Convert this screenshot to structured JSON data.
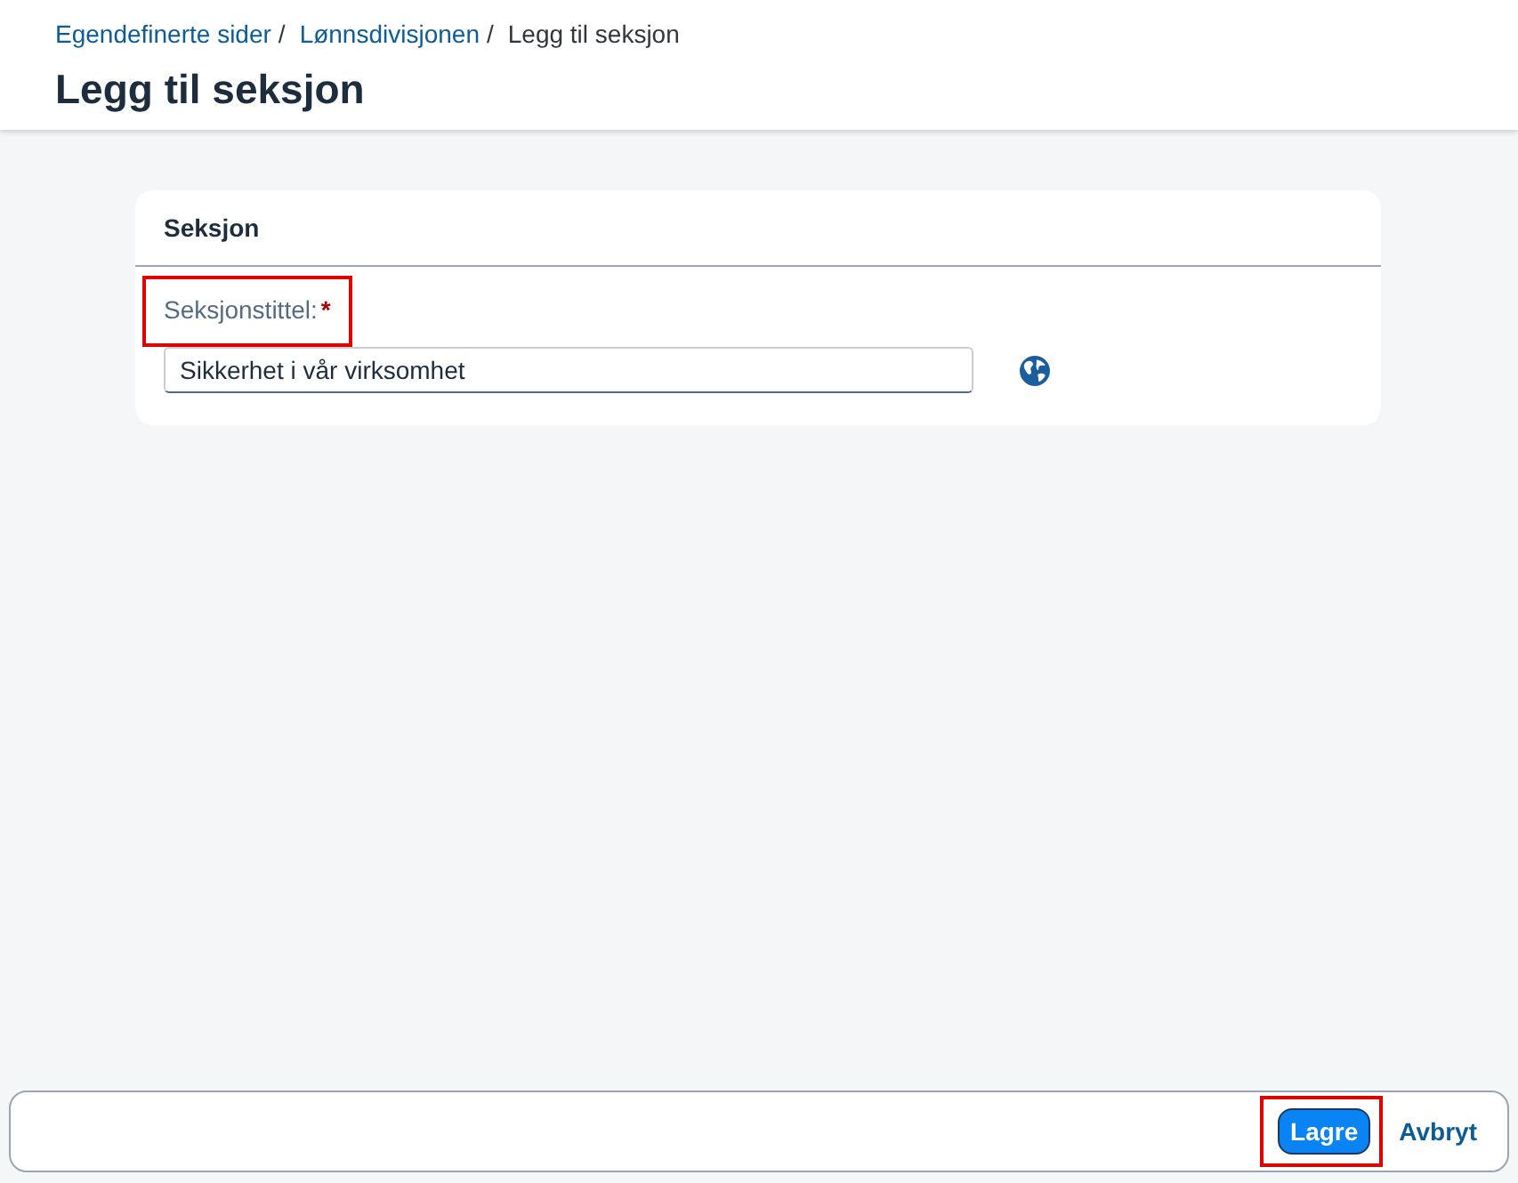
{
  "breadcrumb": [
    {
      "label": "Egendefinerte sider",
      "kind": "link",
      "separator": "/"
    },
    {
      "label": "Lønnsdivisjonen",
      "kind": "link",
      "separator": "/"
    },
    {
      "label": "Legg til seksjon",
      "kind": "current"
    }
  ],
  "page_title": "Legg til seksjon",
  "section": {
    "title": "Seksjon",
    "fields": [
      {
        "label": "Seksjonstittel:",
        "required_mark": "*",
        "value": "Sikkerhet i vår virksomhet",
        "highlighted": true
      }
    ]
  },
  "footer": {
    "buttons": [
      {
        "label": "Lagre",
        "kind": "primary",
        "highlighted": true
      },
      {
        "label": "Avbryt",
        "kind": "link",
        "highlighted": false
      }
    ]
  }
}
